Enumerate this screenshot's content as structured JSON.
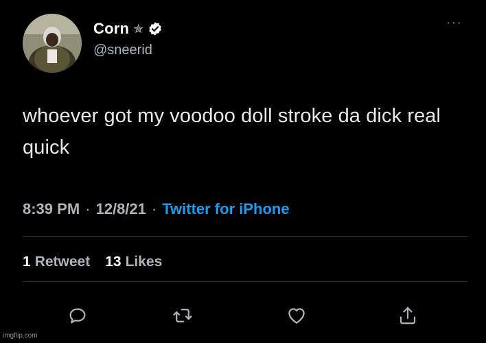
{
  "user": {
    "display_name": "Corn",
    "badge_glyph": "✯",
    "handle": "@sneerid",
    "avatar_icon": "avatar-person-photo"
  },
  "tweet": {
    "text": "whoever got my voodoo doll stroke da dick real quick"
  },
  "meta": {
    "time": "8:39 PM",
    "sep1": "·",
    "date": "12/8/21",
    "sep2": "·",
    "source": "Twitter for iPhone"
  },
  "stats": {
    "retweets_count": "1",
    "retweets_label": "Retweet",
    "likes_count": "13",
    "likes_label": "Likes"
  },
  "actions": {
    "reply": "reply-icon",
    "retweet": "retweet-icon",
    "like": "heart-icon",
    "share": "share-icon"
  },
  "more_glyph": "···",
  "watermark": "imgflip.com",
  "colors": {
    "background": "#000000",
    "link": "#1d9bf0",
    "muted": "#aeb4ba",
    "text": "#e7e9ea"
  }
}
